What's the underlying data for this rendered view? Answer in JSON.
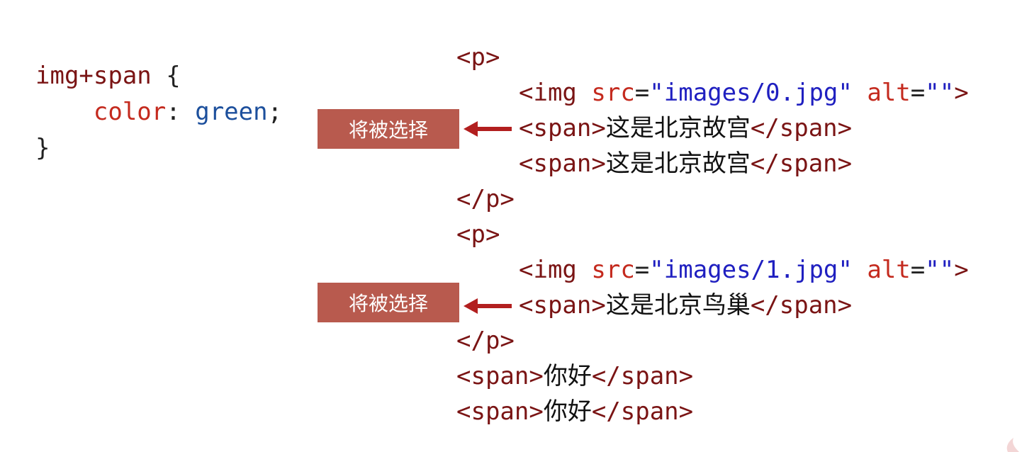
{
  "css_rule": {
    "selector": "img+span",
    "open_brace": "{",
    "property": "color",
    "colon": ":",
    "value": "green",
    "semicolon": ";",
    "close_brace": "}"
  },
  "html_code": {
    "p_open": "<p>",
    "p_close": "</p>",
    "img_open": "<img",
    "src_attr": "src",
    "alt_attr": "alt",
    "eq": "=",
    "img_src_1": "\"images/0.jpg\"",
    "img_src_2": "\"images/1.jpg\"",
    "alt_value": "\"\"",
    "tag_end": ">",
    "span_open": "<span>",
    "span_close": "</span>",
    "text_gugong": "这是北京故宫",
    "text_niaochao": "这是北京鸟巢",
    "text_nihao": "你好"
  },
  "annotations": {
    "badge_label": "将被选择",
    "badge_color": "#b85a4e",
    "arrow_color": "#b21f1f"
  }
}
